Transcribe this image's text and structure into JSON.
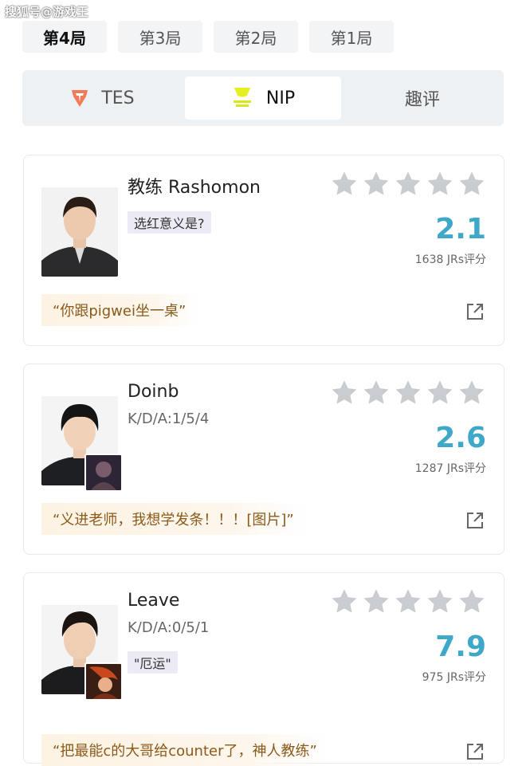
{
  "watermark": "搜狐号@游戏王",
  "round_tabs": [
    {
      "label": "第4局",
      "active": true
    },
    {
      "label": "第3局",
      "active": false
    },
    {
      "label": "第2局",
      "active": false
    },
    {
      "label": "第1局",
      "active": false
    }
  ],
  "team_tabs": [
    {
      "label": "TES",
      "icon": "tes-logo-icon"
    },
    {
      "label": "NIP",
      "icon": "nip-logo-icon",
      "active": true
    },
    {
      "label": "趣评"
    }
  ],
  "colors": {
    "accent": "#3da8c7",
    "star": "#c9ccd1",
    "quote_text": "#8a5a1a"
  },
  "players": [
    {
      "name": "教练 Rashomon",
      "tag": "选红意义是?",
      "rating_stars": 0,
      "score": "2.1",
      "count": "1638 JRs评分",
      "quote": "“你跟pigwei坐一桌”"
    },
    {
      "name": "Doinb",
      "kda": "K/D/A:1/5/4",
      "rating_stars": 0,
      "score": "2.6",
      "count": "1287 JRs评分",
      "quote": "“义进老师，我想学发条！！！[图片]”"
    },
    {
      "name": "Leave",
      "kda": "K/D/A:0/5/1",
      "tag": "\"厄运\"",
      "rating_stars": 0,
      "score": "7.9",
      "count": "975 JRs评分",
      "quote": "“把最能c的大哥给counter了，神人教练”"
    }
  ]
}
